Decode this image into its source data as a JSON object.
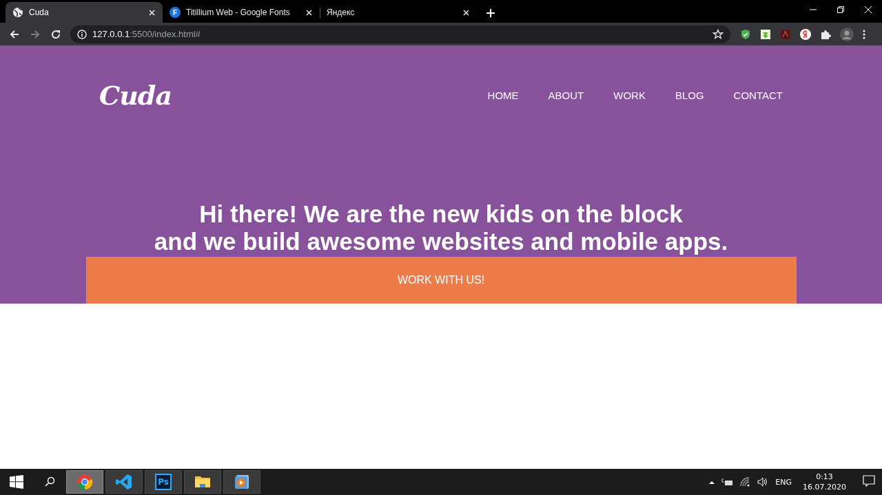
{
  "browser": {
    "tabs": [
      {
        "title": "Cuda",
        "kind": "globe",
        "selected": true
      },
      {
        "title": "Titillium Web - Google Fonts",
        "kind": "letter",
        "icon_letter": "F",
        "selected": false
      },
      {
        "title": "Яндекс",
        "kind": "plain",
        "selected": false
      }
    ],
    "nav_buttons": [
      {
        "kind": "back",
        "disabled": false
      },
      {
        "kind": "forward",
        "disabled": true
      },
      {
        "kind": "reload",
        "disabled": false
      }
    ],
    "address": {
      "host": "127.0.0.1",
      "path": ":5500/index.html#"
    },
    "extensions": [
      {
        "kind": "shield"
      },
      {
        "kind": "download"
      },
      {
        "kind": "pdf"
      },
      {
        "kind": "yandex"
      },
      {
        "kind": "puzzle"
      },
      {
        "kind": "avatar"
      },
      {
        "kind": "menu"
      }
    ]
  },
  "site": {
    "logo": "Cuda",
    "nav": [
      "HOME",
      "ABOUT",
      "WORK",
      "BLOG",
      "CONTACT"
    ],
    "headline": [
      "Hi there! We are the new kids on the block",
      "and we build awesome websites and mobile apps."
    ],
    "cta": "WORK WITH US!"
  },
  "taskbar": {
    "apps": [
      {
        "kind": "chrome",
        "selected": true
      },
      {
        "kind": "vscode",
        "selected": false
      },
      {
        "kind": "photoshop",
        "label": "Ps",
        "selected": false
      },
      {
        "kind": "folder",
        "selected": false
      },
      {
        "kind": "player",
        "selected": false
      }
    ],
    "language": "ENG",
    "time": "0:13",
    "date": "16.07.2020"
  }
}
